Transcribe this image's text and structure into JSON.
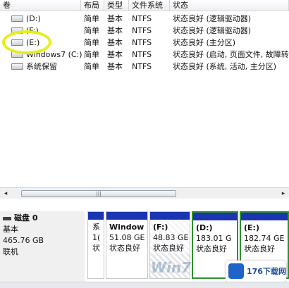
{
  "columns": [
    "卷",
    "布局",
    "类型",
    "文件系统",
    "状态"
  ],
  "volumes": [
    {
      "name": "(D:)",
      "layout": "简单",
      "type": "基本",
      "fs": "NTFS",
      "status": "状态良好 (逻辑驱动器)"
    },
    {
      "name": "(F:)",
      "layout": "简单",
      "type": "基本",
      "fs": "NTFS",
      "status": "状态良好 (逻辑驱动器)"
    },
    {
      "name": "(E:)",
      "layout": "简单",
      "type": "基本",
      "fs": "NTFS",
      "status": "状态良好 (主分区)"
    },
    {
      "name": "Windows7 (C:)",
      "layout": "简单",
      "type": "基本",
      "fs": "NTFS",
      "status": "状态良好 (启动, 页面文件, 故障转"
    },
    {
      "name": "系统保留",
      "layout": "简单",
      "type": "基本",
      "fs": "NTFS",
      "status": "状态良好 (系统, 活动, 主分区)"
    }
  ],
  "scrollbar": {
    "left_arrow": "◂",
    "right_arrow": "▸",
    "thumb_grip": "|||"
  },
  "disk": {
    "name": "磁盘 0",
    "kind": "基本",
    "size": "465.76 GB",
    "state": "联机",
    "partitions": [
      {
        "l1": "系",
        "l2": "1(",
        "l3": "状"
      },
      {
        "l1": "Window",
        "l2": "51.08 GE",
        "l3": "状态良好"
      },
      {
        "l1": "(F:)",
        "l2": "48.83 GE",
        "l3": "状态良好"
      },
      {
        "l1": "(D:)",
        "l2": "183.01 G",
        "l3": "状态良好"
      },
      {
        "l1": "(E:)",
        "l2": "182.74 GE",
        "l3": "状态良好"
      }
    ]
  },
  "watermark": {
    "text": "Win7"
  },
  "logo": {
    "text": "176下载网"
  },
  "colors": {
    "partition_band": "#1b35b0",
    "selected_border": "#2f8f2f",
    "highlight_circle": "#e6ee1a"
  }
}
